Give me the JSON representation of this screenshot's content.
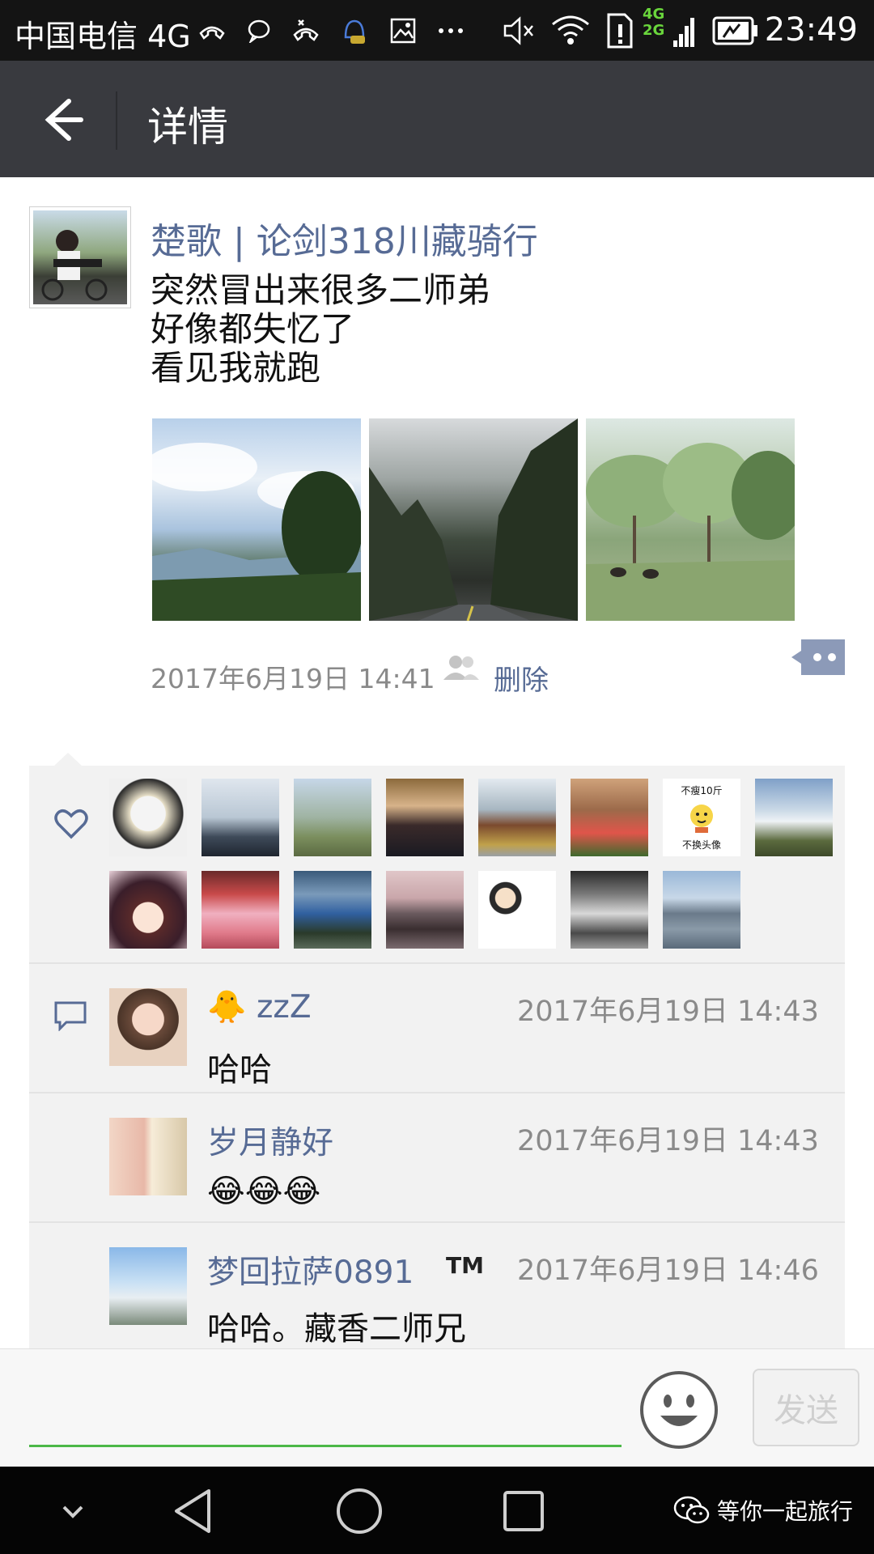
{
  "status_bar": {
    "carrier": "中国电信 4G",
    "time": "23:49",
    "network_badge_top": "4G",
    "network_badge_bottom": "2G"
  },
  "header": {
    "title": "详情",
    "back_icon": "arrow-left-icon"
  },
  "post": {
    "author": "楚歌 | 论剑318川藏骑行",
    "text_lines": [
      "突然冒出来很多二师弟",
      "好像都失忆了",
      "看见我就跑"
    ],
    "timestamp": "2017年6月19日 14:41",
    "delete_label": "删除",
    "photo_count": 3
  },
  "likes": {
    "icon": "heart-icon",
    "avatar_count": 15,
    "avatar_captions": [
      "不瘦10斤",
      "不换头像"
    ]
  },
  "comments": [
    {
      "author": "🐥 zzZ",
      "time": "2017年6月19日 14:43",
      "text": "哈哈"
    },
    {
      "author": "岁月静好",
      "time": "2017年6月19日 14:43",
      "text": "😂😂😂"
    },
    {
      "author": "梦回拉萨0891",
      "tag": "TM",
      "time": "2017年6月19日 14:46",
      "text": "哈哈。藏香二师兄"
    }
  ],
  "input_bar": {
    "send_label": "发送",
    "emoji_icon": "smiley-icon"
  },
  "nav_bar": {
    "watermark": "等你一起旅行"
  },
  "colors": {
    "header_bg": "#393a3f",
    "link_blue": "#576b95",
    "input_green": "#4cb848",
    "panel_bg": "#f2f2f2"
  }
}
